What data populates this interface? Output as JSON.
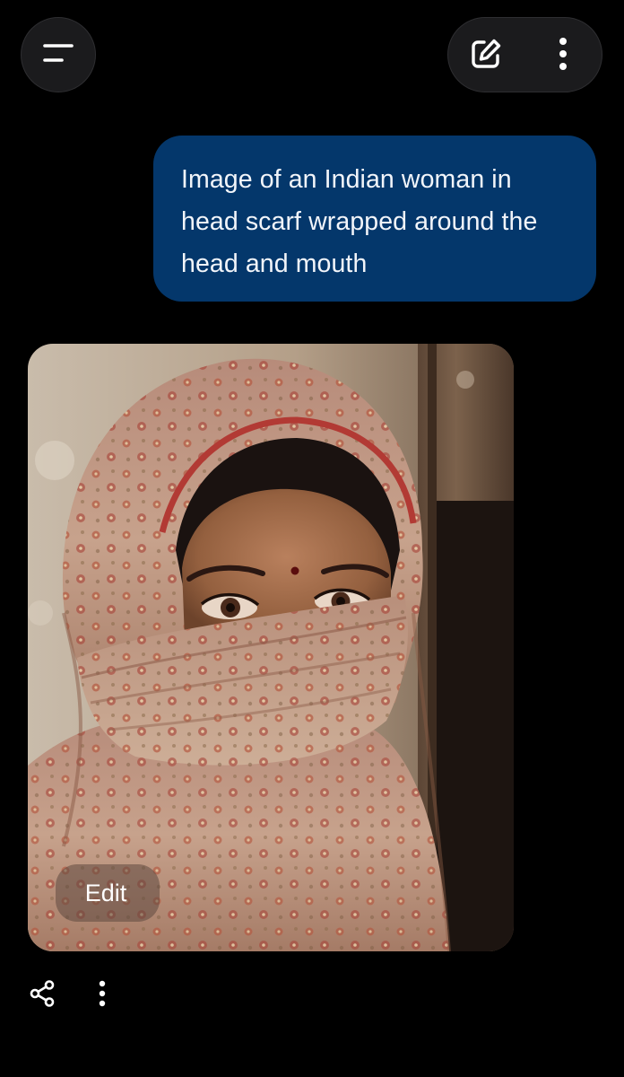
{
  "header": {
    "menu_icon": "menu-icon",
    "new_chat_icon": "edit-square-icon",
    "more_icon": "more-vertical-icon"
  },
  "conversation": {
    "user_message": "Image of an Indian woman in head scarf wrapped around the head and mouth",
    "generated_image": {
      "edit_label": "Edit"
    },
    "actions": {
      "share_icon": "share-icon",
      "more_icon": "more-vertical-icon"
    }
  },
  "colors": {
    "background": "#000000",
    "user_bubble": "#04376b",
    "button_surface": "#1b1b1d"
  }
}
